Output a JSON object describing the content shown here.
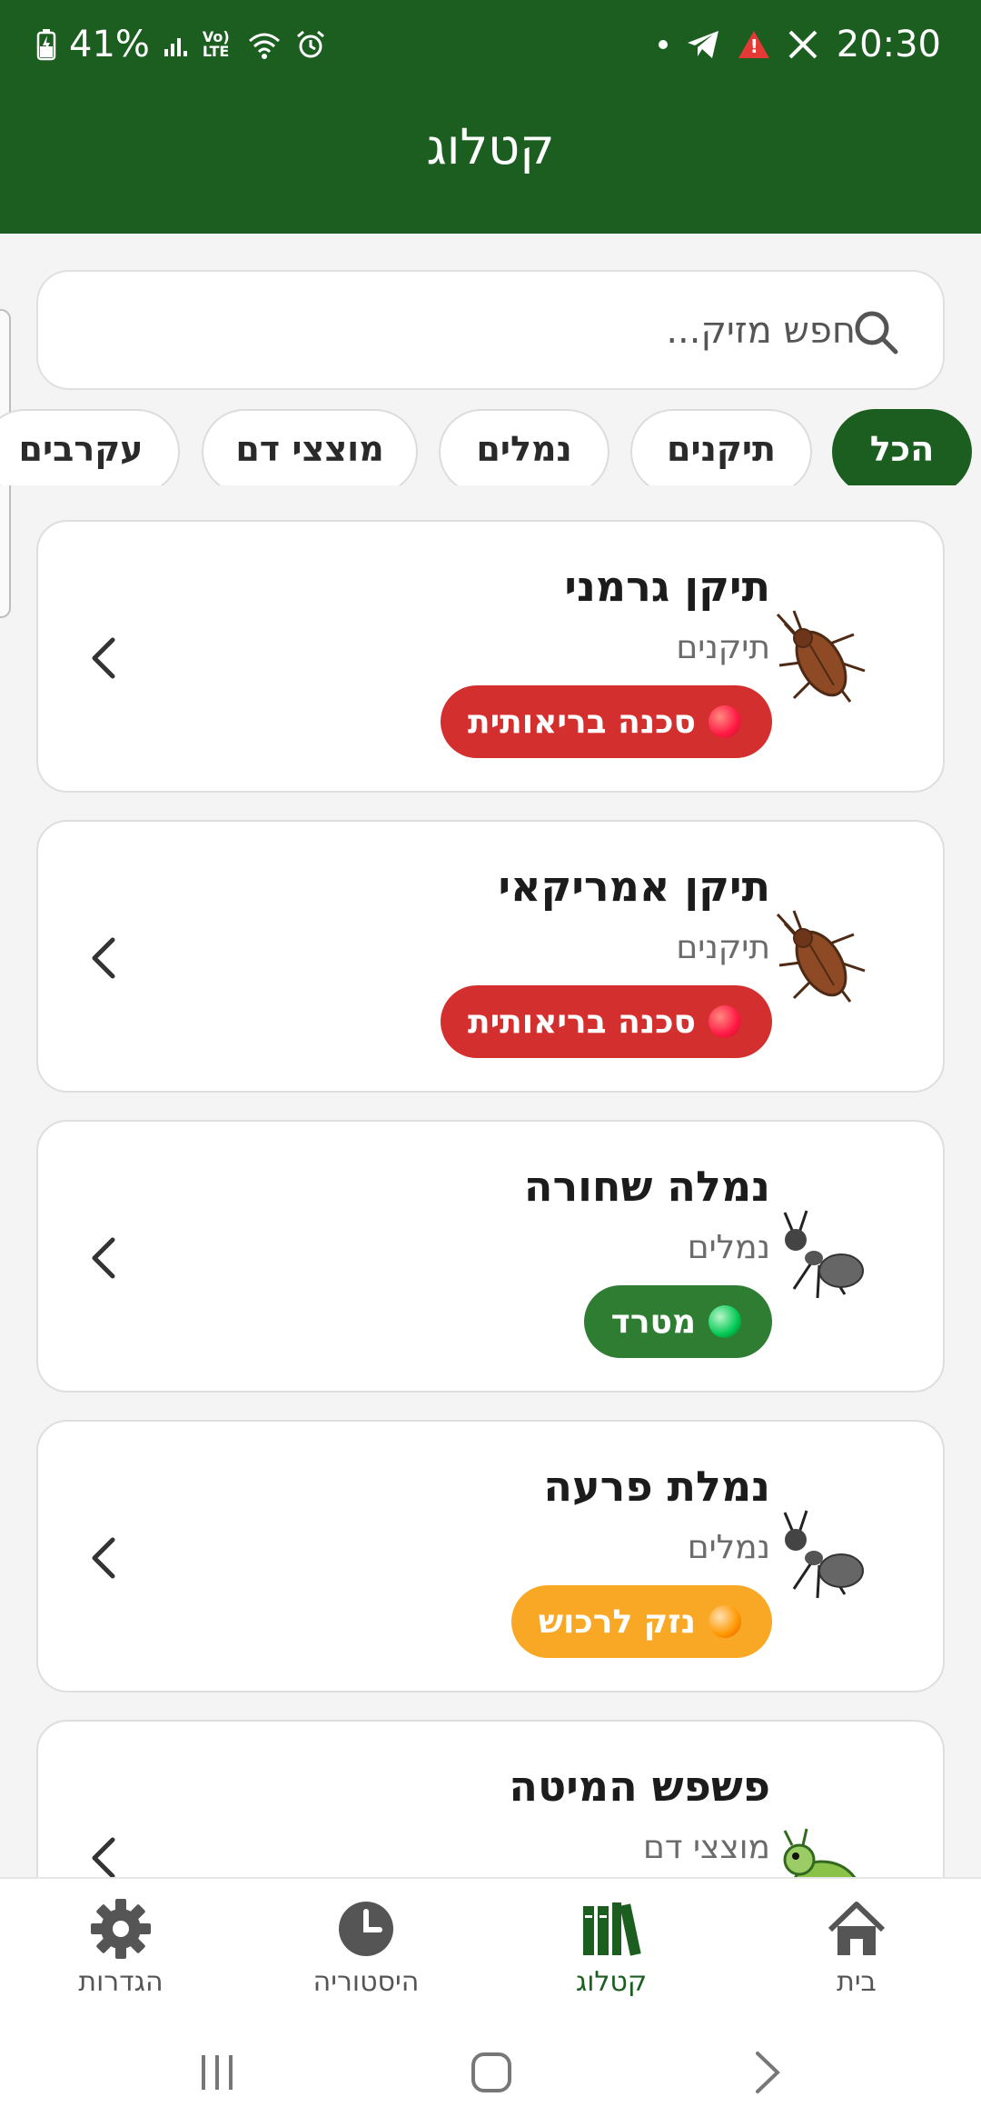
{
  "status_bar": {
    "battery": "41%",
    "time": "20:30",
    "net_label": "Vo) LTE"
  },
  "header": {
    "title": "קטלוג"
  },
  "search": {
    "placeholder": "חפש מזיק...",
    "value": ""
  },
  "filters": [
    {
      "label": "הכל",
      "active": true
    },
    {
      "label": "תיקנים",
      "active": false
    },
    {
      "label": "נמלים",
      "active": false
    },
    {
      "label": "מוצצי דם",
      "active": false
    },
    {
      "label": "עקרבים",
      "active": false
    }
  ],
  "pests": [
    {
      "name": "תיקן גרמני",
      "category": "תיקנים",
      "badge": "סכנה בריאותית",
      "badge_color": "#d32f2f",
      "dot_color": "#ff1744",
      "icon": "cockroach-icon"
    },
    {
      "name": "תיקן אמריקאי",
      "category": "תיקנים",
      "badge": "סכנה בריאותית",
      "badge_color": "#d32f2f",
      "dot_color": "#ff1744",
      "icon": "cockroach-icon"
    },
    {
      "name": "נמלה שחורה",
      "category": "נמלים",
      "badge": "מטרד",
      "badge_color": "#2e7d32",
      "dot_color": "#00c853",
      "icon": "ant-icon"
    },
    {
      "name": "נמלת פרעה",
      "category": "נמלים",
      "badge": "נזק לרכוש",
      "badge_color": "#f9a825",
      "dot_color": "#ff9800",
      "icon": "ant-icon"
    },
    {
      "name": "פשפש המיטה",
      "category": "מוצצי דם",
      "badge": "",
      "badge_color": "#d32f2f",
      "dot_color": "#ff1744",
      "icon": "bug-icon"
    }
  ],
  "bottom_nav": [
    {
      "label": "בית",
      "icon": "home-icon",
      "active": false
    },
    {
      "label": "קטלוג",
      "icon": "catalog-icon",
      "active": true
    },
    {
      "label": "היסטוריה",
      "icon": "history-icon",
      "active": false
    },
    {
      "label": "הגדרות",
      "icon": "settings-icon",
      "active": false
    }
  ],
  "colors": {
    "primary": "#1b5e20",
    "danger": "#d32f2f",
    "nuisance": "#2e7d32",
    "property": "#f9a825"
  }
}
